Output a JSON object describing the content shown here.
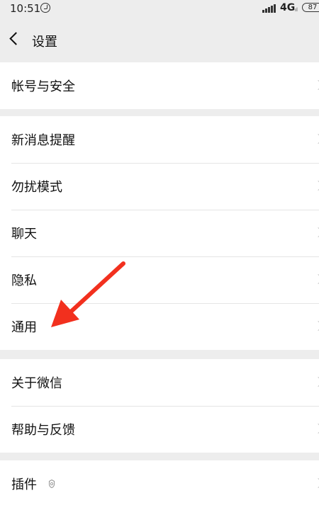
{
  "statusbar": {
    "time": "10:51",
    "network": "4G",
    "network_sub": "ıl",
    "battery": "87"
  },
  "navbar": {
    "title": "设置"
  },
  "groups": [
    {
      "items": [
        {
          "label": "帐号与安全"
        }
      ]
    },
    {
      "items": [
        {
          "label": "新消息提醒"
        },
        {
          "label": "勿扰模式"
        },
        {
          "label": "聊天"
        },
        {
          "label": "隐私"
        },
        {
          "label": "通用"
        }
      ]
    },
    {
      "items": [
        {
          "label": "关于微信"
        },
        {
          "label": "帮助与反馈"
        }
      ]
    },
    {
      "items": [
        {
          "label": "插件"
        }
      ]
    }
  ],
  "colors": {
    "background": "#ededed",
    "annotation_arrow": "#f2301e"
  }
}
